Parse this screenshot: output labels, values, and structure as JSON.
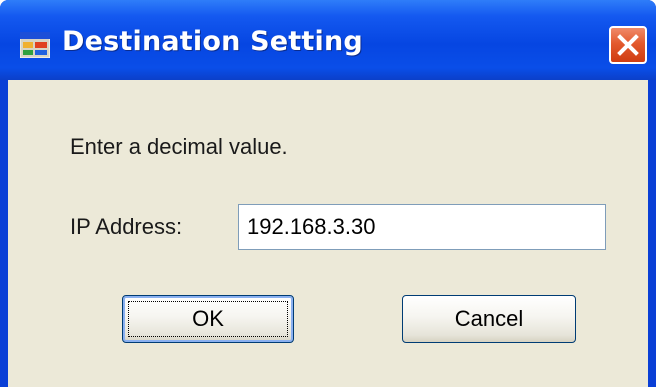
{
  "window": {
    "title": "Destination Setting",
    "icon": "app-window-icon",
    "close_icon": "close-icon",
    "colors": {
      "titlebar": "#0646e2",
      "client": "#ece9d8",
      "close_button": "#e35a2e"
    }
  },
  "dialog": {
    "instruction": "Enter a decimal value.",
    "ip_label": "IP Address:",
    "ip_value": "192.168.3.30",
    "ok_label": "OK",
    "cancel_label": "Cancel"
  }
}
